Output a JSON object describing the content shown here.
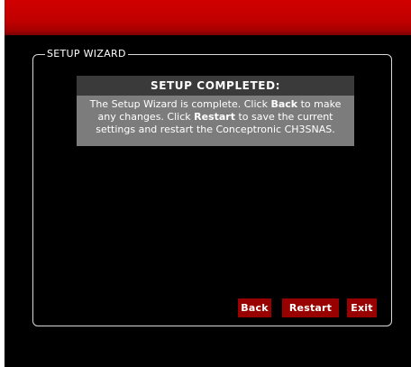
{
  "wizard": {
    "legend": "SETUP WIZARD"
  },
  "status": {
    "title": "SETUP COMPLETED:",
    "line1_pre": "The Setup Wizard is complete.  Click ",
    "line1_bold": "Back",
    "line1_post": " to make",
    "line2_pre": "any changes.  Click ",
    "line2_bold": "Restart",
    "line2_post": " to save the current",
    "line3": "settings and restart the Conceptronic CH3SNAS."
  },
  "buttons": {
    "back": "Back",
    "restart": "Restart",
    "exit": "Exit"
  },
  "colors": {
    "banner": "#c00000",
    "panel_title_bg": "#3a3a3a",
    "panel_body_bg": "#7c7c7c",
    "button_bg": "#990000"
  }
}
